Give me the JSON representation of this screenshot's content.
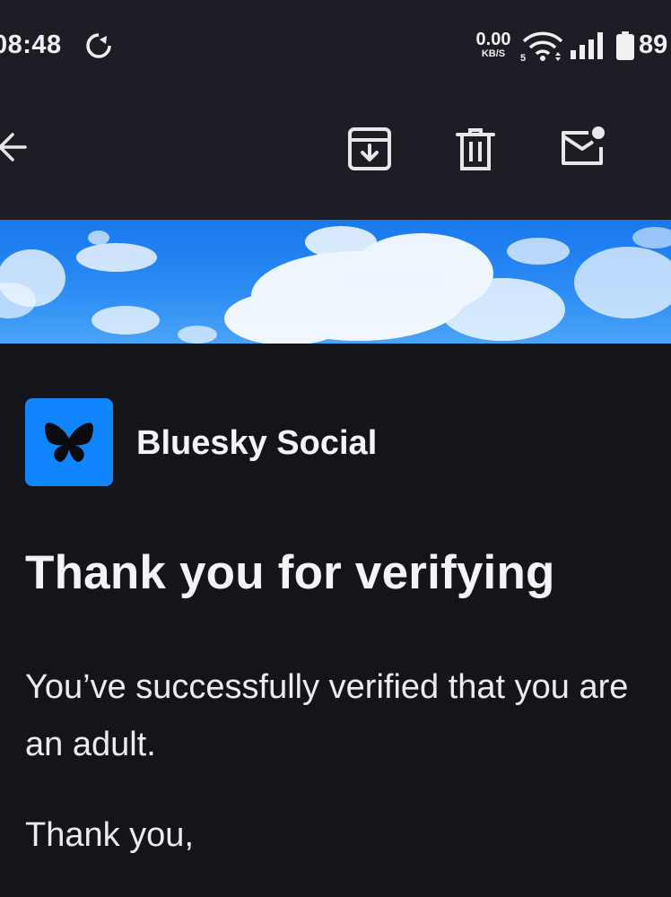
{
  "status_bar": {
    "time": "08:48",
    "net_speed_value": "0.00",
    "net_speed_unit": "KB/S",
    "battery": "89",
    "icons": [
      "sync-icon",
      "wifi-icon",
      "signal-icon",
      "battery-icon"
    ]
  },
  "toolbar": {
    "icons": [
      "back-arrow-icon",
      "archive-icon",
      "trash-icon",
      "mark-unread-icon"
    ]
  },
  "email": {
    "sender": "Bluesky Social",
    "logo_icon": "butterfly-icon",
    "headline": "Thank you for verifying",
    "body": "You’ve successfully verified that you are an adult.",
    "signoff": "Thank you,"
  },
  "colors": {
    "background": "#14151b",
    "toolbar": "#1d1e25",
    "brand_blue": "#1185fe",
    "sky": "#2a8bf3"
  }
}
